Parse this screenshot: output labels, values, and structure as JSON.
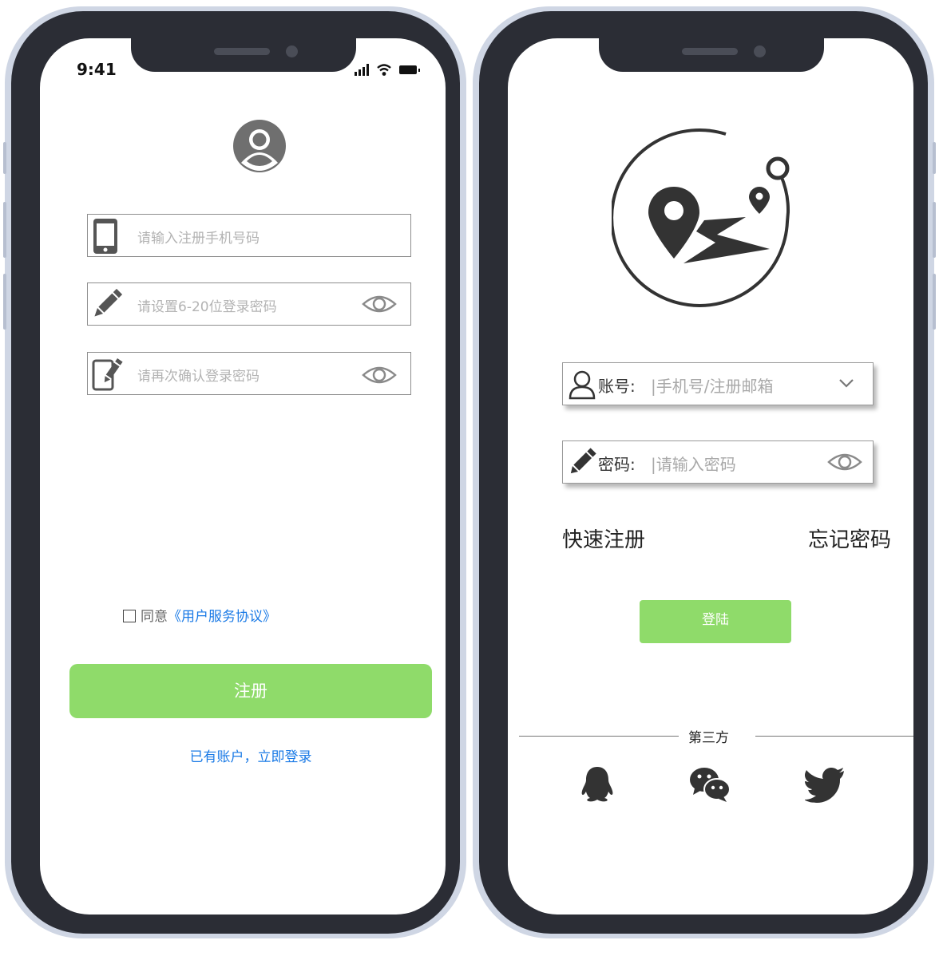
{
  "register_screen": {
    "status_time": "9:41",
    "phone_placeholder": "请输入注册手机号码",
    "password_placeholder": "请设置6-20位登录密码",
    "confirm_placeholder": "请再次确认登录密码",
    "agree_text": "同意",
    "agreement_link": "《用户服务协议》",
    "register_button": "注册",
    "login_link": "已有账户，立即登录"
  },
  "login_screen": {
    "account_label": "账号:",
    "account_placeholder": "|手机号/注册邮箱",
    "password_label": "密码:",
    "password_placeholder": "|请输入密码",
    "quick_register": "快速注册",
    "forgot_password": "忘记密码",
    "login_button": "登陆",
    "third_party_label": "第三方",
    "social_icons": [
      "qq-icon",
      "wechat-icon",
      "twitter-icon"
    ]
  },
  "colors": {
    "accent_green": "#8fdb6a",
    "link_blue": "#1a7ae6",
    "icon_gray": "#555555",
    "frame_dark": "#2b2d35"
  }
}
